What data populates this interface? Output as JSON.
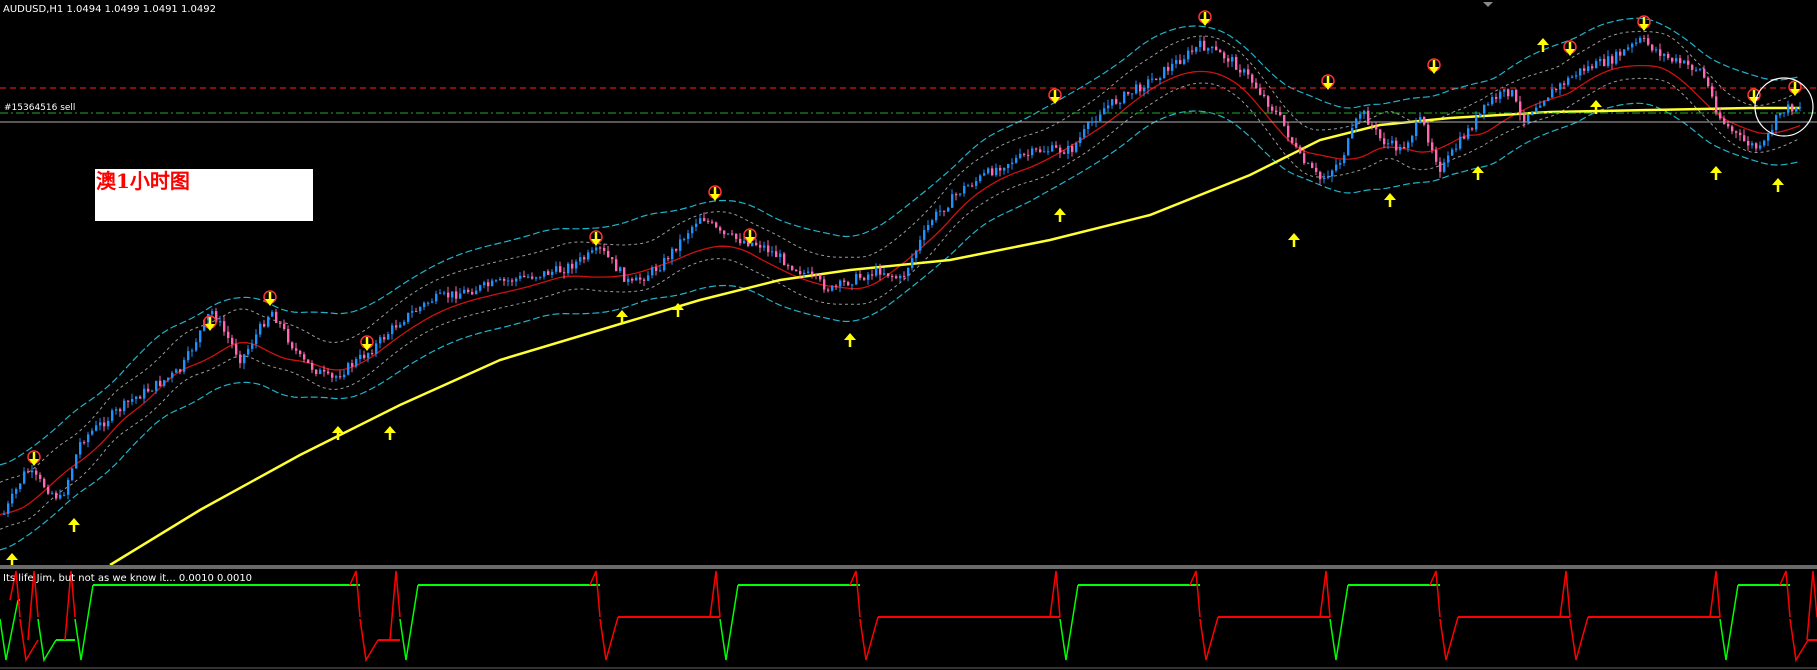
{
  "window": {
    "symbol_line": "AUDUSD,H1  1.0494 1.0499 1.0491 1.0492"
  },
  "order": {
    "label": "#15364516 sell"
  },
  "note": {
    "text": "澳1小时图"
  },
  "subwindow": {
    "label": "Its life Jim, but not as we know it...  0.0010 0.0010"
  },
  "colors": {
    "background": "#000000",
    "bull_candle": "#1e90ff",
    "bear_candle": "#ff69b4",
    "ema_slow": "#ffff33",
    "ema_fast": "#cc1111",
    "band_outer": "#20b2c8",
    "band_inner": "#9a9a9a",
    "up_arrow": "#ffff00",
    "down_arrow": "#ffff00",
    "resistance_line": "#ff2222",
    "order_line": "#22aa22",
    "indicator_up": "#00ff00",
    "indicator_down": "#ff0000"
  },
  "chart_data": {
    "type": "line",
    "series": [],
    "up_signals": 15,
    "down_signals": 15
  }
}
